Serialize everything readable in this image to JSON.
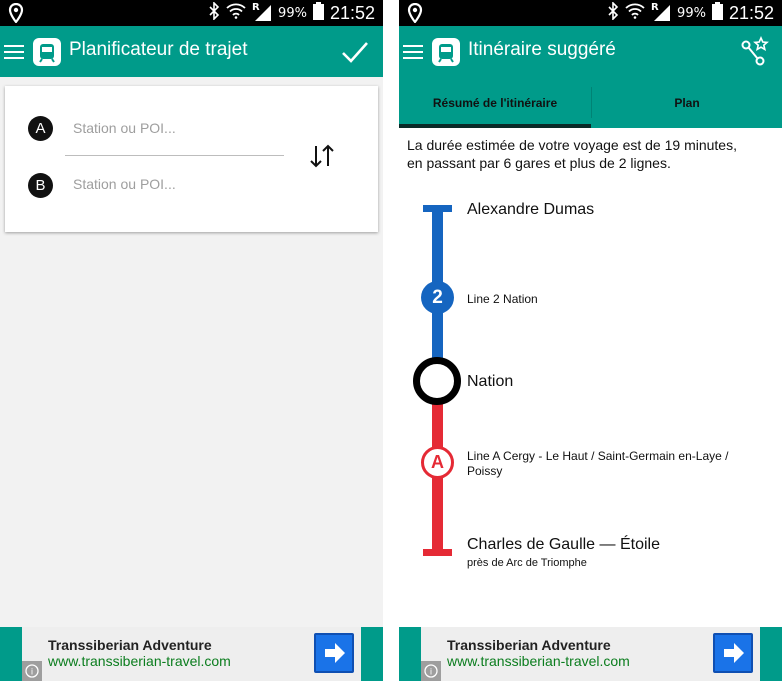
{
  "status_bar": {
    "battery": "99%",
    "signal_indicator": "R",
    "time": "21:52"
  },
  "left_screen": {
    "title": "Planificateur de trajet",
    "origin": {
      "marker": "A",
      "placeholder": "Station ou POI..."
    },
    "destination": {
      "marker": "B",
      "placeholder": "Station ou POI..."
    }
  },
  "right_screen": {
    "title": "Itinéraire suggéré",
    "tabs": [
      {
        "label": "Résumé de l'itinéraire",
        "selected": true
      },
      {
        "label": "Plan",
        "selected": false
      }
    ],
    "summary_line1": "La durée estimée de votre voyage est de 19 minutes,",
    "summary_line2": "en passant par 6 gares et plus de 2 lignes.",
    "route": {
      "start": {
        "name": "Alexandre Dumas"
      },
      "leg1": {
        "badge": "2",
        "label": "Line 2 Nation",
        "color": "#1565c0"
      },
      "transfer": {
        "name": "Nation"
      },
      "leg2": {
        "badge": "A",
        "label_line1": "Line A Cergy - Le Haut / Saint-Germain en-Laye /",
        "label_line2": "Poissy",
        "color": "#e52a35"
      },
      "end": {
        "name": "Charles de Gaulle — Étoile",
        "note": "près de Arc de Triomphe"
      }
    }
  },
  "ad": {
    "title": "Transsiberian Adventure",
    "url": "www.transsiberian-travel.com",
    "info_icon": "i"
  },
  "colors": {
    "app_bar": "#009b8a",
    "status_bar": "#000000",
    "line_2": "#1565c0",
    "line_a": "#e52a35",
    "ad_url": "#0b7d1e",
    "ad_button": "#1a73e8"
  }
}
